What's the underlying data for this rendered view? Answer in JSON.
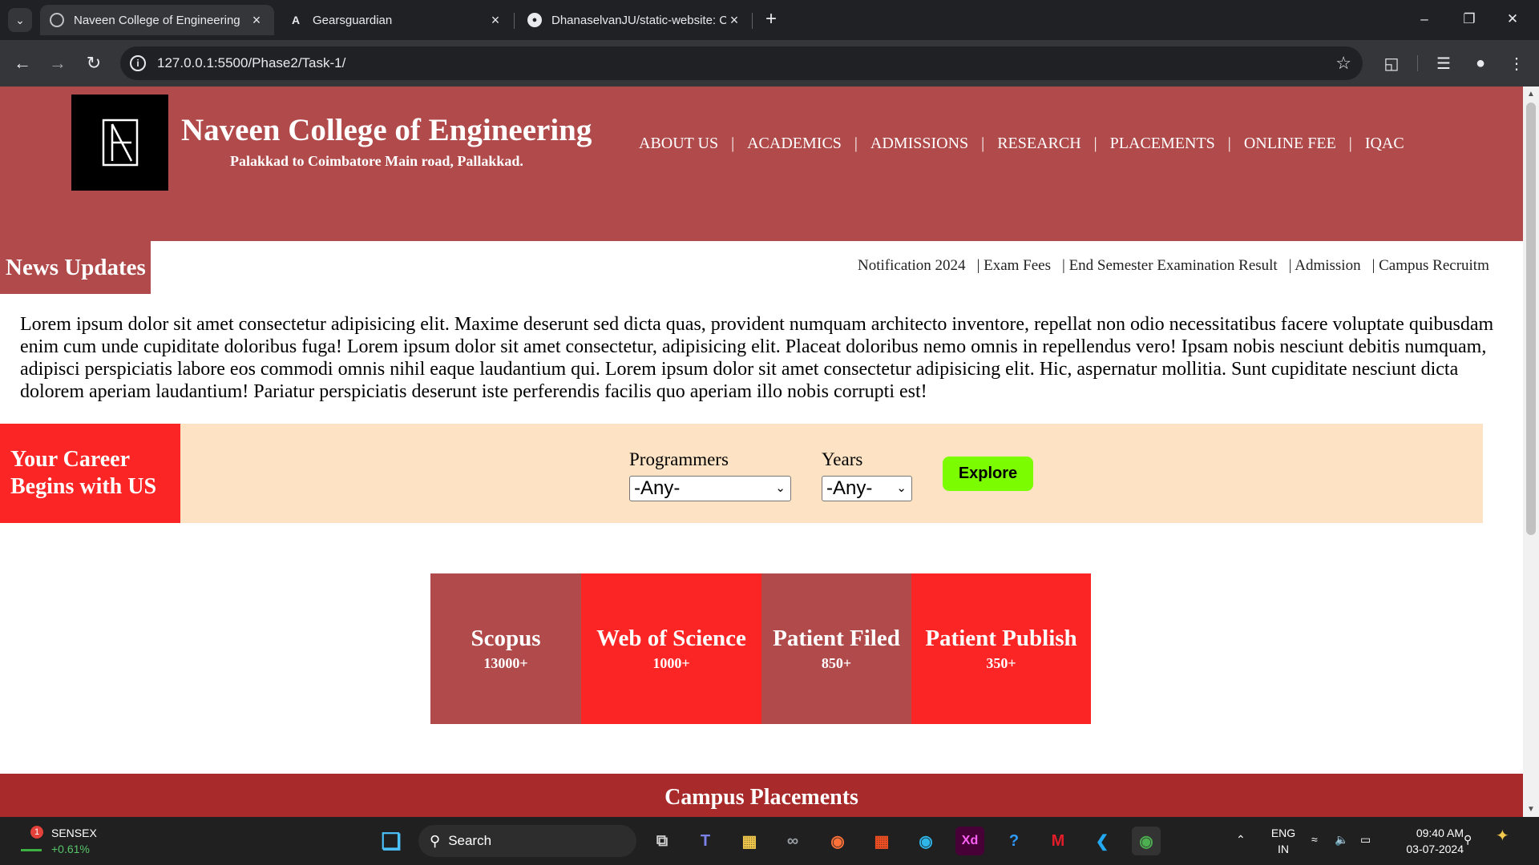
{
  "browser": {
    "tabs": [
      {
        "title": "Naveen College of Engineering",
        "favicon": "globe-icon",
        "active": true
      },
      {
        "title": "Gearsguardian",
        "favicon": "angular-icon",
        "active": false
      },
      {
        "title": "DhanaselvanJU/static-website: C",
        "favicon": "github-icon",
        "active": false
      }
    ],
    "url": "127.0.0.1:5500/Phase2/Task-1/"
  },
  "site": {
    "name": "Naveen College of Engineering",
    "address": "Palakkad to Coimbatore Main road, Pallakkad.",
    "brand_color": "#b04a4b",
    "nav": [
      "ABOUT US",
      "ACADEMICS",
      "ADMISSIONS",
      "RESEARCH",
      "PLACEMENTS",
      "ONLINE FEE",
      "IQAC"
    ],
    "nav_separator": "|"
  },
  "news": {
    "title": "News Updates",
    "items": [
      "Notification 2024",
      "| Exam Fees",
      "| End Semester Examination Result",
      "| Admission",
      "| Campus Recruitm"
    ]
  },
  "intro_text": "Lorem ipsum dolor sit amet consectetur adipisicing elit. Maxime deserunt sed dicta quas, provident numquam architecto inventore, repellat non odio necessitatibus facere voluptate quibusdam enim cum unde cupiditate doloribus fuga! Lorem ipsum dolor sit amet consectetur, adipisicing elit. Placeat doloribus nemo omnis in repellendus vero! Ipsam nobis nesciunt debitis numquam, adipisci perspiciatis labore eos commodi omnis nihil eaque laudantium qui. Lorem ipsum dolor sit amet consectetur adipisicing elit. Hic, aspernatur mollitia. Sunt cupiditate nesciunt dicta dolorem aperiam laudantium! Pariatur perspiciatis deserunt iste perferendis facilis quo aperiam illo nobis corrupti est!",
  "career": {
    "title": "Your Career Begins with US",
    "programmes_label": "Programmers",
    "programmes_value": "-Any-",
    "years_label": "Years",
    "years_value": "-Any-",
    "button": "Explore",
    "button_color": "#7cfc00"
  },
  "stats": [
    {
      "label": "Scopus",
      "value": "13000+",
      "color": "#b04a4b"
    },
    {
      "label": "Web of Science",
      "value": "1000+",
      "color": "#fb2525"
    },
    {
      "label": "Patient Filed",
      "value": "850+",
      "color": "#b04a4b"
    },
    {
      "label": "Patient Publish",
      "value": "350+",
      "color": "#fb2525"
    }
  ],
  "placements_title": "Campus Placements",
  "taskbar": {
    "widget_name": "SENSEX",
    "widget_change": "+0.61%",
    "widget_badge": "1",
    "search_label": "Search",
    "lang": "ENG",
    "region": "IN",
    "time": "09:40 AM",
    "date": "03-07-2024"
  }
}
